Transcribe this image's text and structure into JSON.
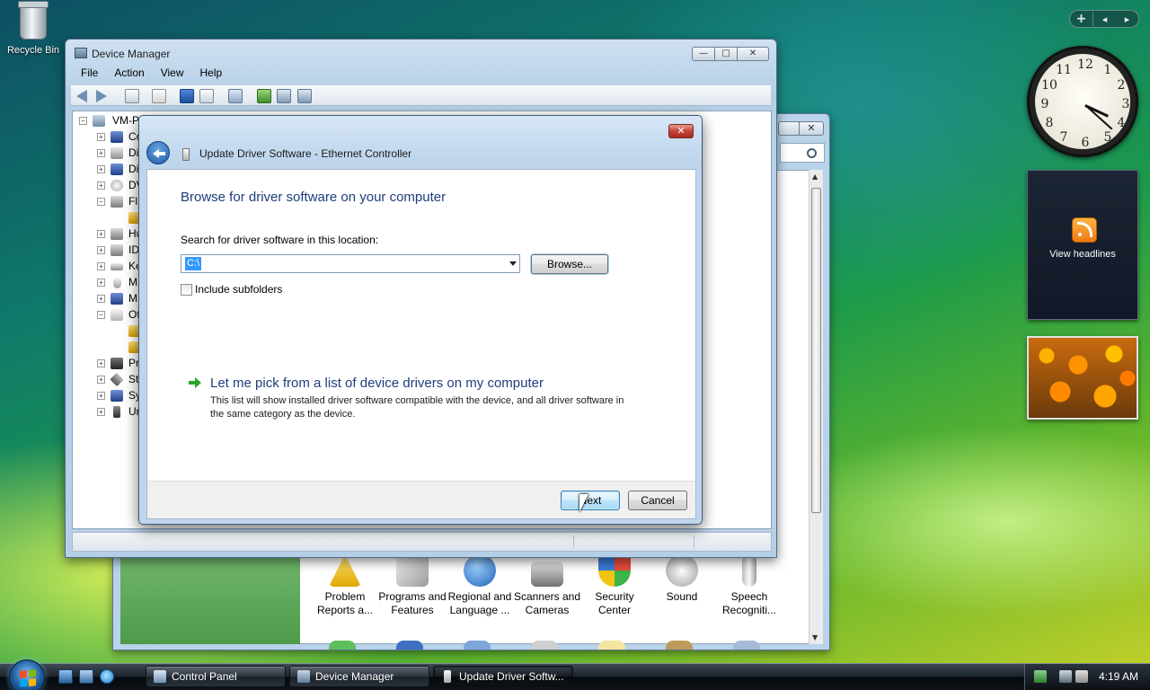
{
  "desktop": {
    "recycle_bin_label": "Recycle Bin",
    "sidebar_add": "+",
    "sidebar_prev": "◂",
    "sidebar_next": "▸",
    "feed_label": "View headlines",
    "clock_numbers": [
      "12",
      "1",
      "2",
      "3",
      "4",
      "5",
      "6",
      "7",
      "8",
      "9",
      "10",
      "11"
    ]
  },
  "control_panel": {
    "close_glyph": "✕",
    "items": [
      {
        "label": "Problem Reports a...",
        "icon": "problem-reports-icon",
        "color": "#f1c232"
      },
      {
        "label": "Programs and Features",
        "icon": "programs-features-icon",
        "color": "#b7b7b7"
      },
      {
        "label": "Regional and Language ...",
        "icon": "regional-language-icon",
        "color": "#4a86e8"
      },
      {
        "label": "Scanners and Cameras",
        "icon": "scanners-cameras-icon",
        "color": "#999999"
      },
      {
        "label": "Security Center",
        "icon": "security-center-icon",
        "color": "#e06666"
      },
      {
        "label": "Sound",
        "icon": "sound-icon",
        "color": "#cccccc"
      },
      {
        "label": "Speech Recogniti...",
        "icon": "speech-recognition-icon",
        "color": "#d9d9d9"
      }
    ]
  },
  "device_manager": {
    "title": "Device Manager",
    "minimize_glyph": "—",
    "maximize_glyph": "□",
    "close_glyph": "✕",
    "menu": [
      "File",
      "Action",
      "View",
      "Help"
    ],
    "toolbar": [
      {
        "name": "back-icon"
      },
      {
        "name": "forward-icon"
      },
      {
        "name": "show-hide-console-tree-icon"
      },
      {
        "name": "properties-icon"
      },
      {
        "name": "help-icon"
      },
      {
        "name": "action-pane-icon"
      },
      {
        "name": "scan-hardware-icon"
      },
      {
        "name": "update-driver-icon"
      },
      {
        "name": "uninstall-icon"
      },
      {
        "name": "disable-icon"
      }
    ],
    "tree": [
      {
        "text": "VM-P",
        "expander": "⊟",
        "level": 0
      },
      {
        "text": "Co",
        "expander": "⊞",
        "level": 1
      },
      {
        "text": "Di",
        "expander": "⊞",
        "level": 1
      },
      {
        "text": "Di",
        "expander": "⊞",
        "level": 1
      },
      {
        "text": "DV",
        "expander": "⊞",
        "level": 1
      },
      {
        "text": "Fl",
        "expander": "⊟",
        "level": 1
      },
      {
        "text": "",
        "expander": "",
        "level": 2
      },
      {
        "text": "Hu",
        "expander": "⊞",
        "level": 1
      },
      {
        "text": "ID",
        "expander": "⊞",
        "level": 1
      },
      {
        "text": "Ke",
        "expander": "⊞",
        "level": 1
      },
      {
        "text": "M",
        "expander": "⊞",
        "level": 1
      },
      {
        "text": "M",
        "expander": "⊞",
        "level": 1
      },
      {
        "text": "Ot",
        "expander": "⊟",
        "level": 1
      },
      {
        "text": "",
        "expander": "",
        "level": 2
      },
      {
        "text": "",
        "expander": "",
        "level": 2
      },
      {
        "text": "Pr",
        "expander": "⊞",
        "level": 1
      },
      {
        "text": "St",
        "expander": "⊞",
        "level": 1
      },
      {
        "text": "Sy",
        "expander": "⊞",
        "level": 1
      },
      {
        "text": "Ur",
        "expander": "⊞",
        "level": 1
      }
    ]
  },
  "update_driver": {
    "title": "Update Driver Software - Ethernet Controller",
    "close_glyph": "✕",
    "heading": "Browse for driver software on your computer",
    "search_label": "Search for driver software in this location:",
    "location_value": "C:\\",
    "browse_label": "Browse...",
    "include_subfolders_label": "Include subfolders",
    "include_subfolders_checked": false,
    "pick_link": "Let me pick from a list of device drivers on my computer",
    "pick_description": "This list will show installed driver software compatible with the device, and all driver software in the same category as the device.",
    "next_label": "Next",
    "cancel_label": "Cancel"
  },
  "taskbar": {
    "tasks": [
      {
        "label": "Control Panel",
        "active": false
      },
      {
        "label": "Device Manager",
        "active": false
      },
      {
        "label": "Update Driver Softw...",
        "active": true
      }
    ],
    "time": "4:19 AM"
  }
}
